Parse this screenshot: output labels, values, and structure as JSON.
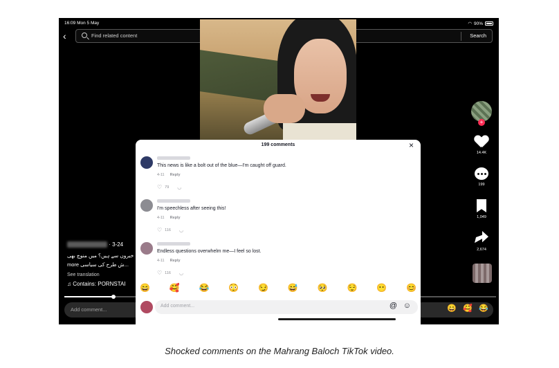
{
  "status_bar": {
    "time": "16:09  Mon 5 May",
    "battery": "90%"
  },
  "search": {
    "placeholder": "Find related content",
    "button_label": "Search"
  },
  "sidebar": {
    "likes": "14.4K",
    "comments": "199",
    "saves": "1,049",
    "shares": "2,674"
  },
  "post": {
    "date": "· 3-24",
    "caption_line1": "خبروں سے ہیں؟ میں منوچ بھی",
    "caption_line2": "more   ش طرح کی سیاسی... ",
    "see_translation": "See translation",
    "contains": "♫ Contains: PORNSTAI"
  },
  "bottom_bar": {
    "placeholder": "Add comment...",
    "emojis": [
      "😄",
      "🥰",
      "😂"
    ]
  },
  "panel": {
    "header": "199 comments",
    "close_icon": "×",
    "comments": [
      {
        "text": "This news is like a bolt out of the blue—I'm caught off guard.",
        "date": "4-11",
        "reply": "Reply",
        "likes": "79",
        "avatar_color": "#2e3a66"
      },
      {
        "text": "I'm speechless after seeing this!",
        "date": "4-11",
        "reply": "Reply",
        "likes": "116",
        "avatar_color": "#8c8c92"
      },
      {
        "text": "Endless questions overwhelm me—I feel so lost.",
        "date": "4-11",
        "reply": "Reply",
        "likes": "116",
        "avatar_color": "#9a7b8a"
      }
    ],
    "emojis": [
      "😄",
      "🥰",
      "😂",
      "😳",
      "😏",
      "😅",
      "🥺",
      "😌",
      "😶",
      "😊"
    ],
    "input_placeholder": "Add comment...",
    "at_icon": "@",
    "emoji_icon": "☺"
  },
  "figure_caption": "Shocked comments on the Mahrang Baloch TikTok video."
}
